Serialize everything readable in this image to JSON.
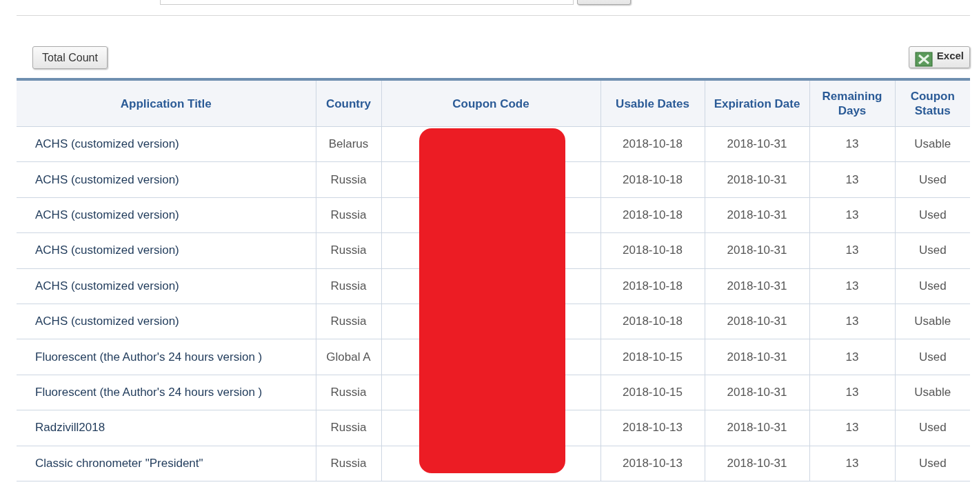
{
  "toolbar": {
    "total_button": "Total Count",
    "excel_button": "Excel"
  },
  "table": {
    "columns": [
      "Application Title",
      "Country",
      "Coupon Code",
      "Usable Dates",
      "Expiration Date",
      "Remaining Days",
      "Coupon Status"
    ],
    "rows": [
      {
        "title": "ACHS (customized version)",
        "country": "Belarus",
        "usable": "2018-10-18",
        "expiration": "2018-10-31",
        "remaining": "13",
        "status": "Usable"
      },
      {
        "title": "ACHS (customized version)",
        "country": "Russia",
        "usable": "2018-10-18",
        "expiration": "2018-10-31",
        "remaining": "13",
        "status": "Used"
      },
      {
        "title": "ACHS (customized version)",
        "country": "Russia",
        "usable": "2018-10-18",
        "expiration": "2018-10-31",
        "remaining": "13",
        "status": "Used"
      },
      {
        "title": "ACHS (customized version)",
        "country": "Russia",
        "usable": "2018-10-18",
        "expiration": "2018-10-31",
        "remaining": "13",
        "status": "Used"
      },
      {
        "title": "ACHS (customized version)",
        "country": "Russia",
        "usable": "2018-10-18",
        "expiration": "2018-10-31",
        "remaining": "13",
        "status": "Used"
      },
      {
        "title": "ACHS (customized version)",
        "country": "Russia",
        "usable": "2018-10-18",
        "expiration": "2018-10-31",
        "remaining": "13",
        "status": "Usable"
      },
      {
        "title": "Fluorescent (the Author's 24 hours version )",
        "country": "Global A",
        "usable": "2018-10-15",
        "expiration": "2018-10-31",
        "remaining": "13",
        "status": "Used"
      },
      {
        "title": "Fluorescent (the Author's 24 hours version )",
        "country": "Russia",
        "usable": "2018-10-15",
        "expiration": "2018-10-31",
        "remaining": "13",
        "status": "Usable"
      },
      {
        "title": "Radzivill2018",
        "country": "Russia",
        "usable": "2018-10-13",
        "expiration": "2018-10-31",
        "remaining": "13",
        "status": "Used"
      },
      {
        "title": "Classic chronometer \"President\"",
        "country": "Russia",
        "usable": "2018-10-13",
        "expiration": "2018-10-31",
        "remaining": "13",
        "status": "Used"
      }
    ]
  }
}
